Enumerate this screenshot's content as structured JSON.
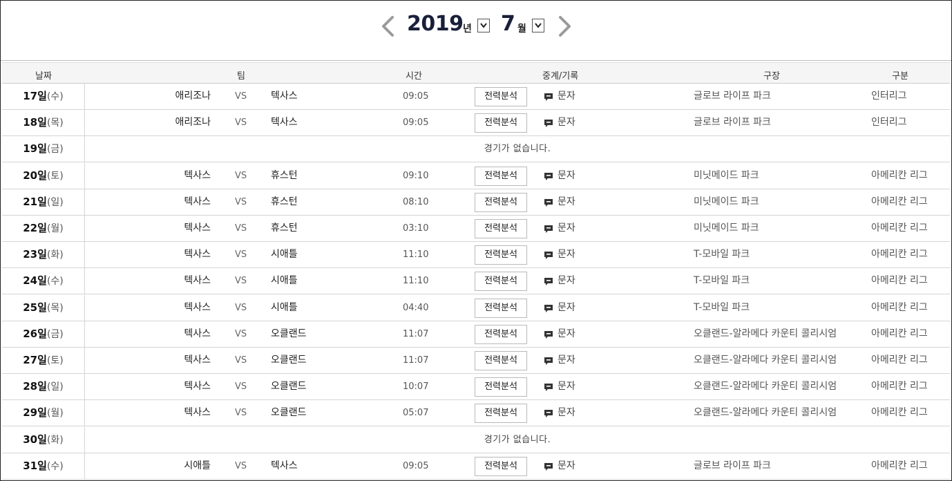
{
  "header": {
    "year": "2019",
    "year_unit": "년",
    "month": "7",
    "month_unit": "월"
  },
  "columns": {
    "date": "날짜",
    "team": "팀",
    "time": "시간",
    "broadcast": "중계/기록",
    "stadium": "구장",
    "category": "구분"
  },
  "labels": {
    "vs": "VS",
    "analysis": "전력분석",
    "text_relay": "문자"
  },
  "rows": [
    {
      "day": "17일",
      "weekday": "(수)",
      "home": "애리조나",
      "away": "텍사스",
      "time": "09:05",
      "stadium": "글로브 라이프 파크",
      "league": "인터리그"
    },
    {
      "day": "18일",
      "weekday": "(목)",
      "home": "애리조나",
      "away": "텍사스",
      "time": "09:05",
      "stadium": "글로브 라이프 파크",
      "league": "인터리그"
    },
    {
      "day": "19일",
      "weekday": "(금)",
      "nogame": "경기가 없습니다."
    },
    {
      "day": "20일",
      "weekday": "(토)",
      "home": "텍사스",
      "away": "휴스턴",
      "time": "09:10",
      "stadium": "미닛메이드 파크",
      "league": "아메리칸 리그"
    },
    {
      "day": "21일",
      "weekday": "(일)",
      "home": "텍사스",
      "away": "휴스턴",
      "time": "08:10",
      "stadium": "미닛메이드 파크",
      "league": "아메리칸 리그"
    },
    {
      "day": "22일",
      "weekday": "(월)",
      "home": "텍사스",
      "away": "휴스턴",
      "time": "03:10",
      "stadium": "미닛메이드 파크",
      "league": "아메리칸 리그"
    },
    {
      "day": "23일",
      "weekday": "(화)",
      "home": "텍사스",
      "away": "시애틀",
      "time": "11:10",
      "stadium": "T-모바일 파크",
      "league": "아메리칸 리그"
    },
    {
      "day": "24일",
      "weekday": "(수)",
      "home": "텍사스",
      "away": "시애틀",
      "time": "11:10",
      "stadium": "T-모바일 파크",
      "league": "아메리칸 리그"
    },
    {
      "day": "25일",
      "weekday": "(목)",
      "home": "텍사스",
      "away": "시애틀",
      "time": "04:40",
      "stadium": "T-모바일 파크",
      "league": "아메리칸 리그"
    },
    {
      "day": "26일",
      "weekday": "(금)",
      "home": "텍사스",
      "away": "오클랜드",
      "time": "11:07",
      "stadium": "오클랜드-알라메다 카운티 콜리시엄",
      "league": "아메리칸 리그"
    },
    {
      "day": "27일",
      "weekday": "(토)",
      "home": "텍사스",
      "away": "오클랜드",
      "time": "11:07",
      "stadium": "오클랜드-알라메다 카운티 콜리시엄",
      "league": "아메리칸 리그"
    },
    {
      "day": "28일",
      "weekday": "(일)",
      "home": "텍사스",
      "away": "오클랜드",
      "time": "10:07",
      "stadium": "오클랜드-알라메다 카운티 콜리시엄",
      "league": "아메리칸 리그"
    },
    {
      "day": "29일",
      "weekday": "(월)",
      "home": "텍사스",
      "away": "오클랜드",
      "time": "05:07",
      "stadium": "오클랜드-알라메다 카운티 콜리시엄",
      "league": "아메리칸 리그"
    },
    {
      "day": "30일",
      "weekday": "(화)",
      "nogame": "경기가 없습니다."
    },
    {
      "day": "31일",
      "weekday": "(수)",
      "home": "시애틀",
      "away": "텍사스",
      "time": "09:05",
      "stadium": "글로브 라이프 파크",
      "league": "아메리칸 리그"
    }
  ]
}
